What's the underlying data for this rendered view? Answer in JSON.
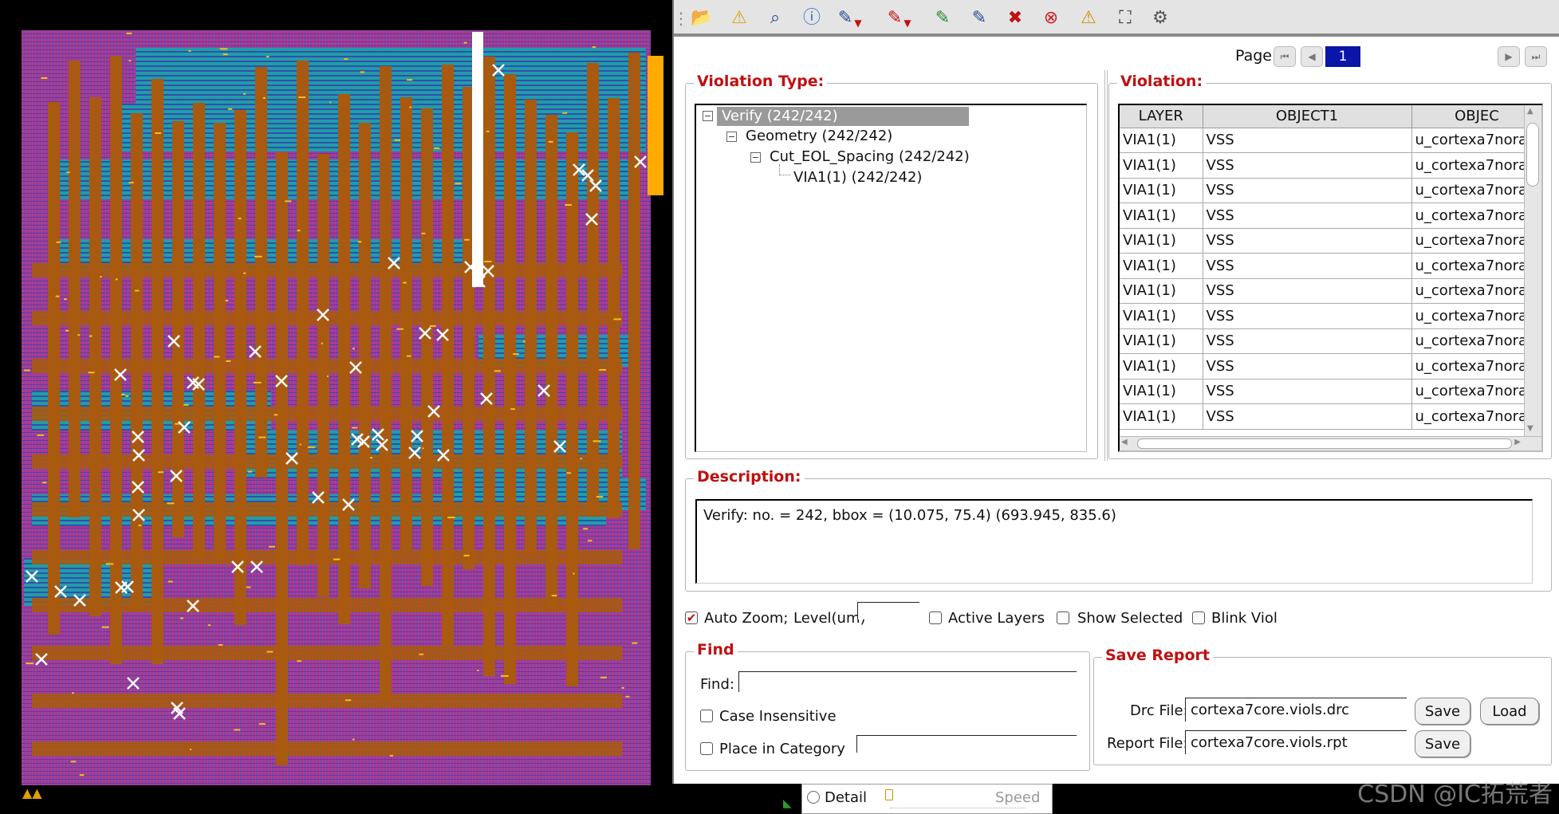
{
  "toolbar": {
    "icons": [
      "open-folder-icon",
      "warning-pen-icon",
      "zoom-select-icon",
      "info-icon",
      "select-pen-icon",
      "mark-pen-icon",
      "fix-pen-icon",
      "clear-pen-icon",
      "delete-icon",
      "stop-icon",
      "warning-icon",
      "network-icon",
      "settings-icon"
    ]
  },
  "pager": {
    "label": "Page:",
    "current": "1"
  },
  "violation_type": {
    "title": "Violation Type:",
    "tree": [
      {
        "label": "Verify (242/242)",
        "selected": true
      },
      {
        "label": "Geometry (242/242)"
      },
      {
        "label": "Cut_EOL_Spacing (242/242)"
      },
      {
        "label": "VIA1(1) (242/242)"
      }
    ]
  },
  "violation": {
    "title": "Violation:",
    "columns": [
      "LAYER",
      "OBJECT1",
      "OBJEC"
    ],
    "rows": [
      [
        "VIA1(1)",
        "VSS",
        "u_cortexa7nora"
      ],
      [
        "VIA1(1)",
        "VSS",
        "u_cortexa7nora"
      ],
      [
        "VIA1(1)",
        "VSS",
        "u_cortexa7nora"
      ],
      [
        "VIA1(1)",
        "VSS",
        "u_cortexa7nora"
      ],
      [
        "VIA1(1)",
        "VSS",
        "u_cortexa7nora"
      ],
      [
        "VIA1(1)",
        "VSS",
        "u_cortexa7nora"
      ],
      [
        "VIA1(1)",
        "VSS",
        "u_cortexa7nora"
      ],
      [
        "VIA1(1)",
        "VSS",
        "u_cortexa7nora"
      ],
      [
        "VIA1(1)",
        "VSS",
        "u_cortexa7nora"
      ],
      [
        "VIA1(1)",
        "VSS",
        "u_cortexa7nora"
      ],
      [
        "VIA1(1)",
        "VSS",
        "u_cortexa7nora"
      ],
      [
        "VIA1(1)",
        "VSS",
        "u_cortexa7nora"
      ]
    ]
  },
  "description": {
    "title": "Description:",
    "text": "Verify: no. = 242, bbox = (10.075, 75.4) (693.945, 835.6)"
  },
  "options": {
    "auto_zoom": {
      "label": "Auto Zoom;",
      "checked": true
    },
    "level_label": "Level(um)",
    "level_value": "",
    "active_layers": {
      "label": "Active Layers",
      "checked": false
    },
    "show_selected": {
      "label": "Show Selected",
      "checked": false
    },
    "blink_viol": {
      "label": "Blink Viol",
      "checked": false
    }
  },
  "find": {
    "title": "Find",
    "find_label": "Find:",
    "find_value": "",
    "case_insensitive": {
      "label": "Case Insensitive",
      "checked": false
    },
    "place_in_category": {
      "label": "Place in Category",
      "checked": false
    },
    "category_value": ""
  },
  "save_report": {
    "title": "Save Report",
    "drc_label": "Drc File:",
    "drc_value": "cortexa7core.viols.drc",
    "report_label": "Report File:",
    "report_value": "cortexa7core.viols.rpt",
    "save_label": "Save",
    "load_label": "Load"
  },
  "bottom": {
    "detail_label": "Detail",
    "speed_label": "Speed"
  },
  "watermark": "CSDN @IC拓荒者",
  "colors": {
    "accent_red": "#c01010",
    "page_blue": "#0b15a8",
    "metal_orange": "#a85a10",
    "metal_cyan": "#10a6a6",
    "metal_magenta": "#a0309a"
  }
}
